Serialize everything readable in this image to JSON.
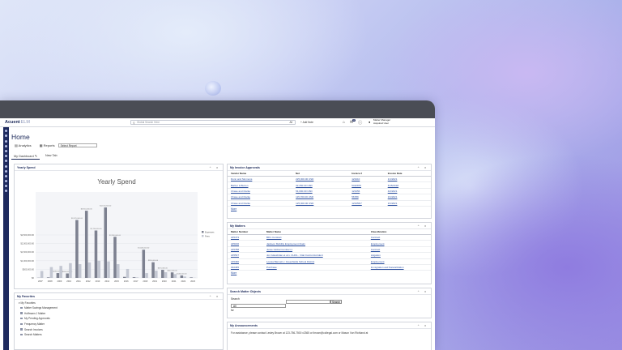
{
  "app": {
    "brand": "Acuent",
    "brand_suffix": "ELM"
  },
  "search": {
    "placeholder": "Global Search Here",
    "scope": "All"
  },
  "header": {
    "add_note": "Add Note",
    "badge_count": "12",
    "user_role": "Matter Manager",
    "user_name": "Acquired User"
  },
  "page": {
    "title": "Home"
  },
  "actions": {
    "analytics": "Analytics",
    "reports": "Reports",
    "select_report": "Select Report"
  },
  "tabs": [
    {
      "label": "My Dashboard"
    },
    {
      "label": "New Tab"
    }
  ],
  "yearly_spend": {
    "panel_title": "Yearly Spend"
  },
  "chart_data": {
    "type": "bar",
    "title": "Yearly Spend",
    "categories": [
      "2007",
      "2008",
      "2009",
      "2010",
      "2011",
      "2012",
      "2013",
      "2014",
      "2015",
      "2016",
      "2017",
      "2018",
      "2019",
      "2020",
      "2021",
      "2022",
      "2023"
    ],
    "series": [
      {
        "name": "Expenses",
        "values": [
          10000,
          30000,
          280000,
          260000,
          3370000,
          3910000,
          2760000,
          4100000,
          2390000,
          60000,
          40000,
          1640000,
          910000,
          470000,
          320000,
          140000,
          30000
        ]
      },
      {
        "name": "Fees",
        "values": [
          400000,
          630000,
          700000,
          860000,
          800000,
          900000,
          1000000,
          960000,
          800000,
          520000,
          30000,
          280000,
          420000,
          330000,
          220000,
          80000,
          10000
        ]
      }
    ],
    "y_ticks": [
      "$0",
      "$500,000.00",
      "$1,000,000.00",
      "$1,500,000.00",
      "$2,000,000.00",
      "$2,500,000.00"
    ],
    "ylim": [
      0,
      5000000
    ],
    "legend_position": "right",
    "colors": {
      "Expenses": "#7d8190",
      "Fees": "#c3c7d2"
    }
  },
  "invoice_approvals": {
    "panel_title": "My Invoice Approvals",
    "columns": [
      "Vendor Name",
      "Net",
      "Invoice #",
      "Invoice Date"
    ],
    "rows": [
      [
        "Dunn and Simmons",
        "225,000.00 USD",
        "123410",
        "1/1/2021"
      ],
      [
        "Barber & Burton",
        "32,250.00 USD",
        "5432876",
        "6/15/2018"
      ],
      [
        "Chase and Clarke",
        "54,000.00 USD",
        "123456",
        "4/2/2021"
      ],
      [
        "Chase and Clarke",
        "115,700.00 USD",
        "56789",
        "3/1/2021"
      ],
      [
        "Chase and Clarke",
        "125,000.00 USD",
        "123456/7",
        "3/1/2021"
      ]
    ],
    "more": "More"
  },
  "matters": {
    "panel_title": "My Matters",
    "columns": [
      "Matter Number",
      "Matter Name",
      "Classification"
    ],
    "rows": [
      [
        "225473",
        "BD's Contract",
        "Contract"
      ],
      [
        "225166",
        "Jackson Mobility Employment Claim",
        "Employment"
      ],
      [
        "225788",
        "Jesse Global Contract 1",
        "Contract"
      ],
      [
        "225537",
        "Jon Glasshdan et al v. CHOL - Vital Control Accident",
        "Litigation"
      ],
      [
        "225490",
        "Louisa Bannett v. Greenfields School District",
        "Employment"
      ],
      [
        "302465",
        "Purchase",
        "Immigration and Naturalization"
      ]
    ],
    "more": "More"
  },
  "search_matter": {
    "panel_title": "Search Matter Objects",
    "label": "Search",
    "scope": "All",
    "button": "Search",
    "for_label": "for"
  },
  "favorites": {
    "panel_title": "My Favorites",
    "root": "My Favorites",
    "items": [
      "Matter Savings Management",
      "Hoffmann J Matter",
      "My Pending Approvals",
      "Frequency Matter",
      "Search Invoices",
      "Search Matters"
    ]
  },
  "announcements": {
    "panel_title": "My Announcements",
    "text": "For assistance, please contact Lesley Brown at 123-756-7500 x2365 or lbrown@collegal.com or Mason Von Richland at"
  }
}
